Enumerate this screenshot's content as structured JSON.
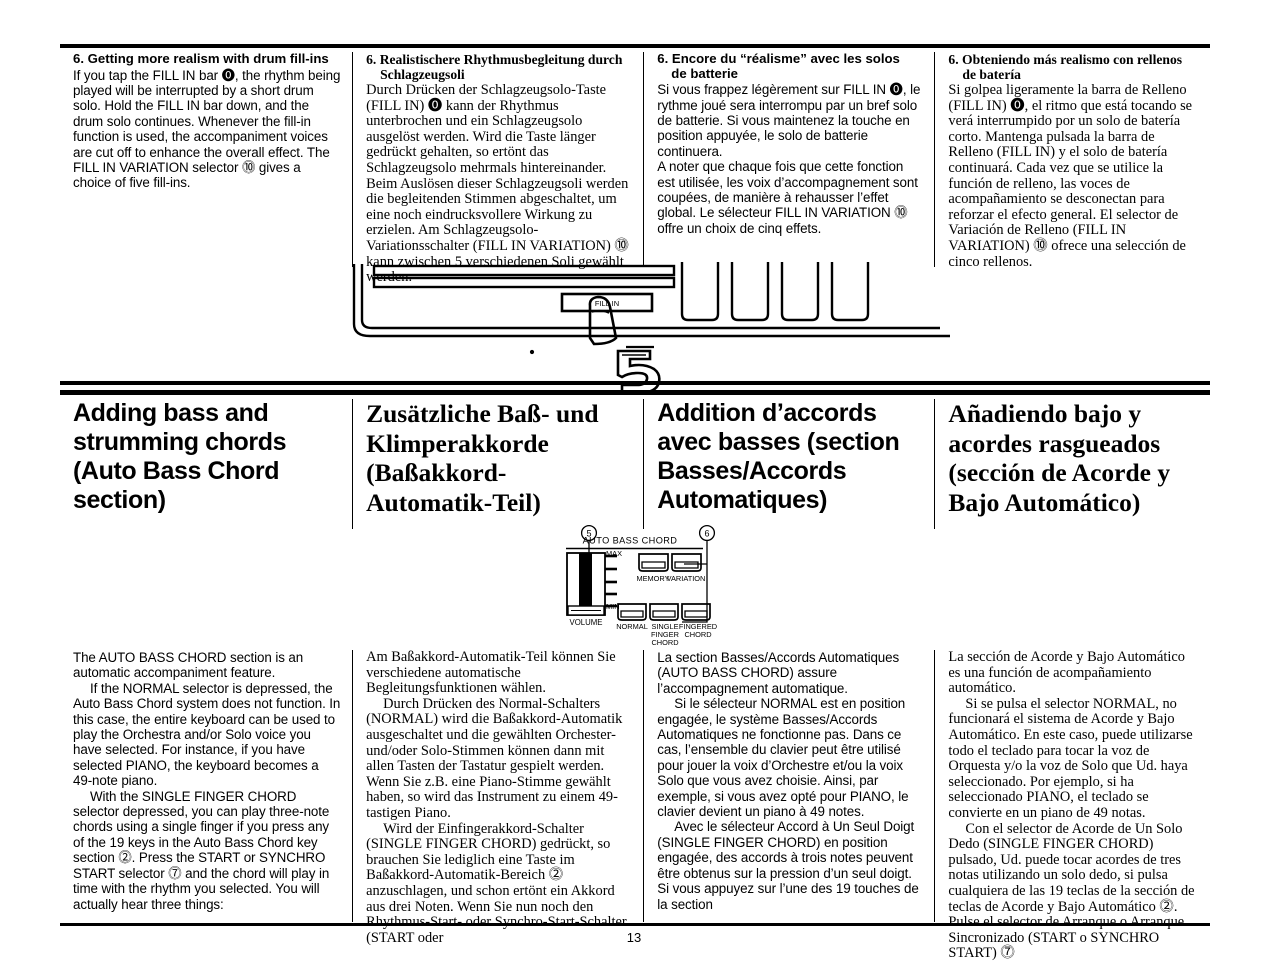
{
  "page": {
    "number": "13"
  },
  "top_section": {
    "columns": [
      {
        "lang": "en",
        "heading": "6. Getting more realism with drum fill-ins",
        "heading_cont": "",
        "paragraphs": [
          "If you tap the FILL IN bar ⓿, the rhythm being played will be interrupted by a short drum solo. Hold the FILL IN bar down, and the drum solo continues. Whenever the fill-in function is used, the accompaniment voices are cut off to enhance the overall effect. The FILL IN VARIATION selector ⓾ gives a choice of five fill-ins."
        ]
      },
      {
        "lang": "de",
        "heading": "6. Realistischere Rhythmusbegleitung durch",
        "heading_cont": "Schlagzeugsoli",
        "paragraphs": [
          "Durch Drücken der Schlagzeugsolo-Taste (FILL IN) ⓿ kann der Rhythmus unterbrochen und ein Schlagzeugsolo ausgelöst werden. Wird die Taste länger gedrückt gehalten, so ertönt das Schlagzeugsolo mehrmals hintereinander. Beim Auslösen dieser Schlagzeugsoli werden die begleitenden Stimmen abgeschaltet, um eine noch eindrucksvollere Wirkung zu erzielen. Am Schlagzeugsolo-Variationsschalter (FILL IN VARIATION) ⓾ kann zwischen 5 verschiedenen Soli gewählt werden."
        ]
      },
      {
        "lang": "fr",
        "heading": "6. Encore du “réalisme” avec les solos",
        "heading_cont": "de batterie",
        "paragraphs": [
          "Si vous frappez légèrement sur FILL IN ⓿, le rythme joué sera interrompu par un bref solo de batterie. Si vous maintenez la touche en position appuyée, le solo de batterie continuera.",
          "A noter que chaque fois que cette fonction est utilisée, les voix d’accompagnement sont coupées, de manière à rehausser l’effet global. Le sélecteur FILL IN VARIATION ⓾ offre un choix de cinq effets."
        ]
      },
      {
        "lang": "es",
        "heading": "6. Obteniendo más realismo con rellenos",
        "heading_cont": "de batería",
        "paragraphs": [
          "Si golpea ligeramente la barra de Relleno (FILL IN) ⓿, el ritmo que está tocando se verá interrumpido por un solo de batería corto. Mantenga pulsada la barra de Relleno (FILL IN) y el solo de batería continuará. Cada vez que se utilice la función de relleno, las voces de acompañamiento se desconectan para reforzar el efecto general. El selector de Variación de Relleno (FILL IN VARIATION) ⓾ ofrece una selección de cinco rellenos."
        ]
      }
    ]
  },
  "keyboard_illustration": {
    "fill_in_label": "FILL IN",
    "chapter_number": "5"
  },
  "section_titles": [
    {
      "lang": "en",
      "title": "Adding bass and strumming chords (Auto Bass Chord section)"
    },
    {
      "lang": "de",
      "title": "Zusätzliche Baß- und Klimperakkorde (Baßakkord-Automatik-Teil)"
    },
    {
      "lang": "fr",
      "title": "Addition d’accords avec basses (section Basses/Accords Automatiques)"
    },
    {
      "lang": "es",
      "title": "Añadiendo bajo y acordes rasgueados (sección de Acorde y Bajo Automático)"
    }
  ],
  "abc_diagram": {
    "panel_title": "AUTO BASS CHORD",
    "callout_left": "5",
    "callout_right": "6",
    "slider": {
      "label": "VOLUME",
      "max_label": "MAX",
      "min_label": "MIN"
    },
    "upper_buttons": [
      {
        "label": "MEMORY"
      },
      {
        "label": "VARIATION"
      }
    ],
    "lower_buttons": [
      {
        "label": "NORMAL"
      },
      {
        "label": "SINGLE FINGER CHORD"
      },
      {
        "label": "FINGERED CHORD"
      }
    ]
  },
  "body_section": {
    "columns": [
      {
        "lang": "en",
        "paragraphs": [
          "The AUTO BASS CHORD section is an automatic accompaniment feature.",
          "If the NORMAL selector is depressed, the Auto Bass Chord system does not function. In this case, the entire keyboard can be used to play the Orchestra and/or Solo voice you have selected. For instance, if you have selected PIANO, the keyboard becomes a 49-note piano.",
          "With the SINGLE FINGER CHORD selector depressed, you can play three-note chords using a single finger if you press any of the 19 keys in the Auto Bass Chord key section ⓶. Press the START or SYNCHRO START selector ⓻ and the chord will play in time with the rhythm you selected. You will actually hear three things:"
        ]
      },
      {
        "lang": "de",
        "paragraphs": [
          "Am Baßakkord-Automatik-Teil können Sie verschiedene automatische Begleitungsfunktionen wählen.",
          "Durch Drücken des Normal-Schalters (NORMAL) wird die Baßakkord-Automatik ausgeschaltet und die gewählten Orchester- und/oder Solo-Stimmen können dann mit allen Tasten der Tastatur gespielt werden. Wenn Sie z.B. eine Piano-Stimme gewählt haben, so wird das Instrument zu einem 49-tastigen Piano.",
          "Wird der Einfingerakkord-Schalter (SINGLE FINGER CHORD) gedrückt, so brauchen Sie lediglich eine Taste im Baßakkord-Automatik-Bereich ⓶ anzuschlagen, und schon ertönt ein Akkord aus drei Noten. Wenn Sie nun noch den Rhythmus-Start- oder Synchro-Start-Schalter (START oder"
        ]
      },
      {
        "lang": "fr",
        "paragraphs": [
          "La section Basses/Accords Automatiques (AUTO BASS CHORD) assure l’accompagnement automatique.",
          "Si le sélecteur NORMAL est en position engagée, le système Basses/Accords Automatiques ne fonctionne pas. Dans ce cas, l’ensemble du clavier peut être utilisé pour jouer la voix d’Orchestre et/ou la voix Solo que vous avez choisie. Ainsi, par exemple, si vous avez opté pour PIANO, le clavier devient un piano à 49 notes.",
          "Avec le sélecteur Accord à Un Seul Doigt (SINGLE FINGER CHORD) en position engagée, des accords à trois notes peuvent être obtenus sur la pression d’un seul doigt. Si vous appuyez sur l’une des 19 touches de la section"
        ]
      },
      {
        "lang": "es",
        "paragraphs": [
          "La sección de Acorde y Bajo Automático es una función de acompañamiento automático.",
          "Si se pulsa el selector NORMAL, no funcionará el sistema de Acorde y Bajo Automático. En este caso, puede utilizarse todo el teclado para tocar la voz de Orquesta y/o la voz de Solo que Ud. haya seleccionado. Por ejemplo, si ha seleccionado PIANO, el teclado se convierte en un piano de 49 notas.",
          "Con el selector de Acorde de Un Solo Dedo (SINGLE FINGER CHORD) pulsado, Ud. puede tocar acordes de tres notas utilizando un solo dedo, si pulsa cualquiera de las 19 teclas de la sección de teclas de Acorde y Bajo Automático ⓶. Pulse el selector de Arranque o Arranque Sincronizado (START o SYNCHRO START) ⓻"
        ]
      }
    ]
  }
}
